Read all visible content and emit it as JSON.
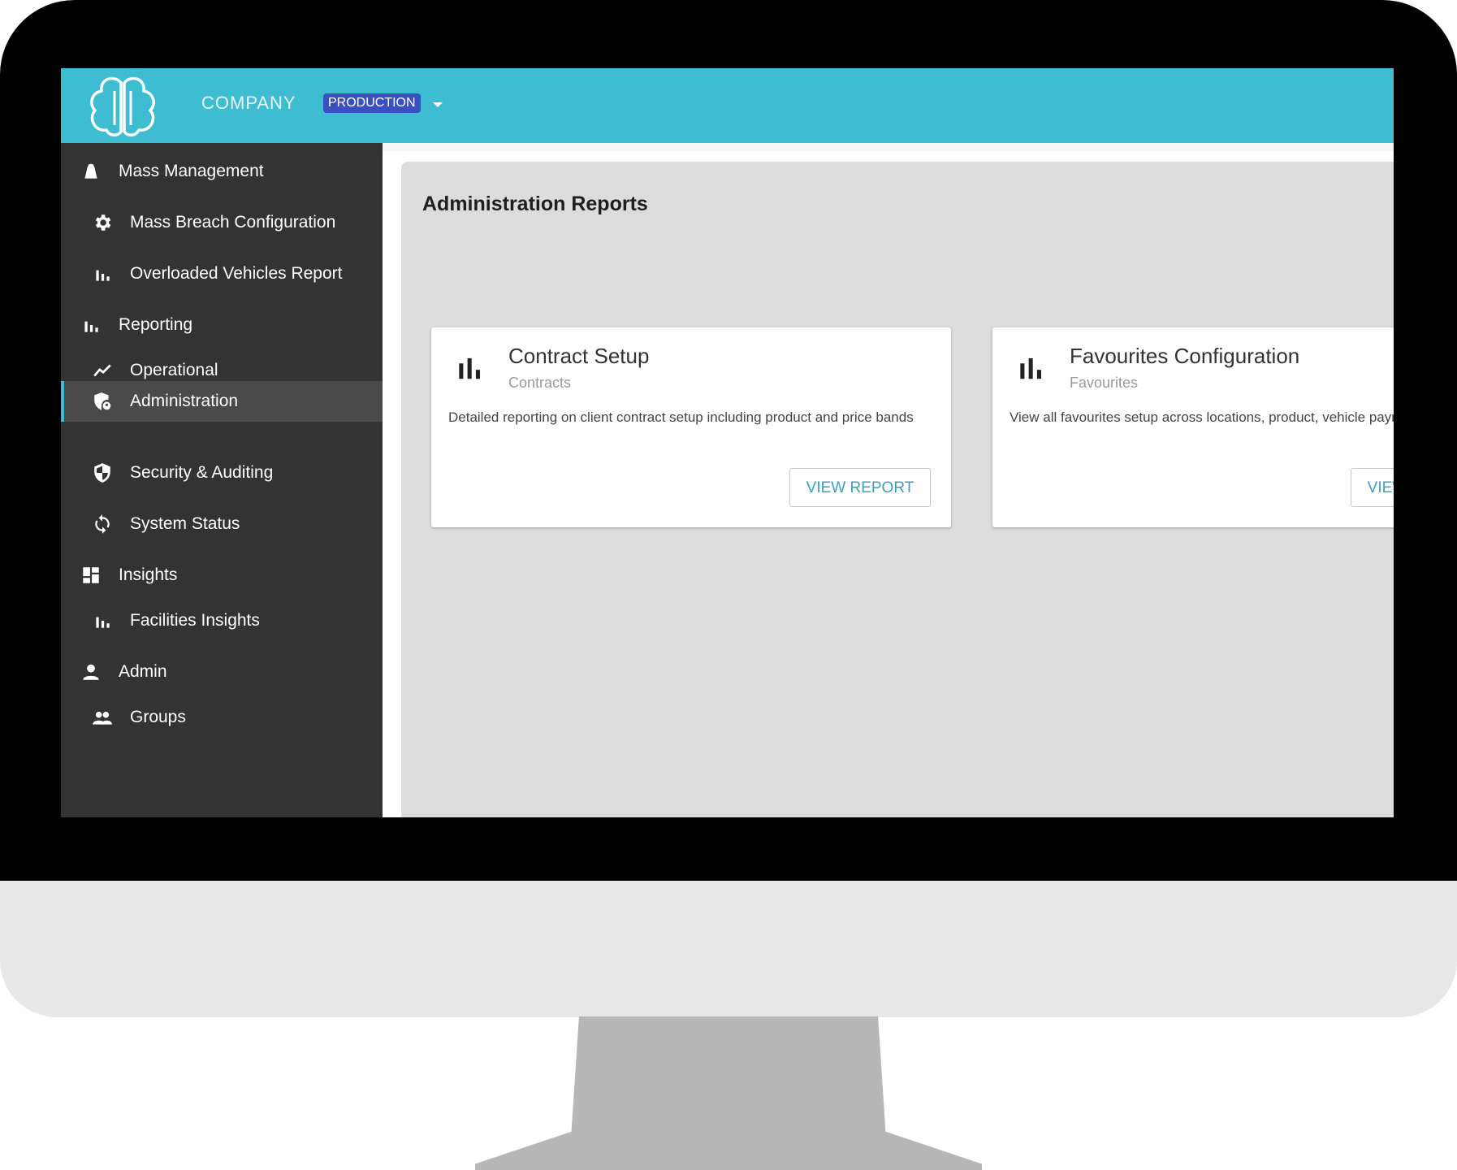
{
  "header": {
    "company": "COMPANY",
    "environment": "PRODUCTION"
  },
  "sidebar": {
    "items": [
      {
        "label": "Mass Management",
        "icon": "bag-icon",
        "level": "section"
      },
      {
        "label": "Mass Breach Configuration",
        "icon": "gear-icon",
        "level": "sub"
      },
      {
        "label": "Overloaded Vehicles Report",
        "icon": "bar-chart-icon",
        "level": "sub"
      },
      {
        "label": "Reporting",
        "icon": "bar-chart-icon",
        "level": "section"
      },
      {
        "label": "Operational",
        "icon": "trend-line-icon",
        "level": "sub"
      },
      {
        "label": "Administration",
        "icon": "admin-shield-icon",
        "level": "sub",
        "active": true
      },
      {
        "label": "Security & Auditing",
        "icon": "security-shield-icon",
        "level": "sub"
      },
      {
        "label": "System Status",
        "icon": "sync-icon",
        "level": "sub"
      },
      {
        "label": "Insights",
        "icon": "dashboard-icon",
        "level": "section"
      },
      {
        "label": "Facilities Insights",
        "icon": "bar-chart-icon",
        "level": "sub"
      },
      {
        "label": "Admin",
        "icon": "person-icon",
        "level": "section"
      },
      {
        "label": "Groups",
        "icon": "group-icon",
        "level": "sub"
      }
    ]
  },
  "main": {
    "title": "Administration Reports",
    "cards": [
      {
        "title": "Contract Setup",
        "subtitle": "Contracts",
        "description": "Detailed reporting on client contract setup including product and price bands",
        "button": "VIEW REPORT",
        "icon": "bar-chart-icon"
      },
      {
        "title": "Favourites Configuration",
        "subtitle": "Favourites",
        "description": "View all favourites setup across locations, product, vehicle payment types",
        "button": "VIEW REPORT",
        "icon": "bar-chart-icon"
      }
    ]
  },
  "colors": {
    "topbar": "#3dbcd2",
    "sidebar": "#333333",
    "environment_badge": "#3a4fc0",
    "button_text": "#3c9fb8"
  }
}
